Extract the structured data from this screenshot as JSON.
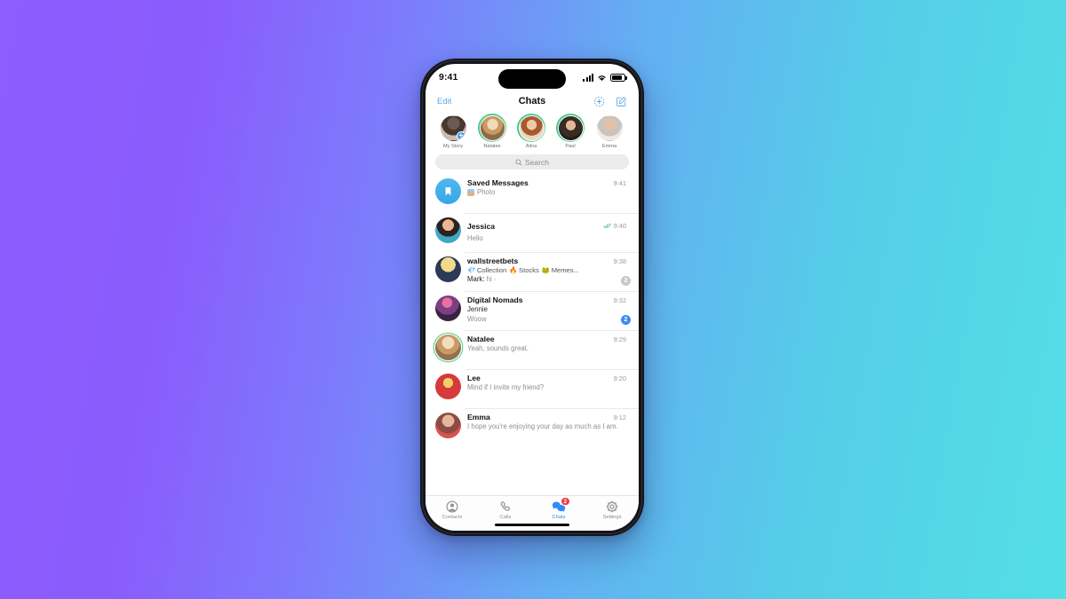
{
  "background": {
    "gradient_from": "#8f5cff",
    "gradient_to": "#53dfe6"
  },
  "phone": {
    "status_bar": {
      "time": "9:41",
      "signal_icon": "cellular-bars-icon",
      "wifi_icon": "wifi-icon",
      "battery_icon": "battery-icon"
    },
    "nav_bar": {
      "edit_label": "Edit",
      "title": "Chats",
      "new_story_icon": "add-story-icon",
      "compose_icon": "compose-icon"
    },
    "stories": [
      {
        "name": "My Story",
        "unread": false,
        "add_badge": "+"
      },
      {
        "name": "Natalee",
        "unread": true
      },
      {
        "name": "Alina",
        "unread": true
      },
      {
        "name": "Paul",
        "unread": true
      },
      {
        "name": "Emma",
        "unread": false
      }
    ],
    "search": {
      "placeholder": "Search",
      "icon": "search-icon"
    },
    "chats": [
      {
        "name": "Saved Messages",
        "avatar_type": "saved-bookmark",
        "preview": "Photo",
        "has_thumb": true,
        "time": "9:41"
      },
      {
        "name": "Jessica",
        "preview": "Hello",
        "time": "9:40",
        "read_receipt": "double-check"
      },
      {
        "name": "wallstreetbets",
        "topics": [
          {
            "emoji": "💎",
            "label": "Collection"
          },
          {
            "emoji": "🔥",
            "label": "Stocks"
          },
          {
            "emoji": "🐸",
            "label": "Memes..."
          }
        ],
        "sender": "Mark:",
        "preview": "hi",
        "chevron": "›",
        "time": "9:38",
        "badge": "2",
        "badge_style": "muted"
      },
      {
        "name": "Digital Nomads",
        "sender": "Jennie",
        "preview": "Woow",
        "time": "9:32",
        "badge": "2",
        "badge_style": "blue"
      },
      {
        "name": "Natalee",
        "preview": "Yeah, sounds great.",
        "time": "9:29",
        "story_ring": true
      },
      {
        "name": "Lee",
        "preview": "Mind if I invite my friend?",
        "time": "9:20"
      },
      {
        "name": "Emma",
        "preview": "I hope you're enjoying your day as much as I am.",
        "time": "9:12"
      }
    ],
    "tabs": [
      {
        "label": "Contacts",
        "icon": "person-icon",
        "active": false
      },
      {
        "label": "Calls",
        "icon": "phone-icon",
        "active": false
      },
      {
        "label": "Chats",
        "icon": "chat-bubbles-icon",
        "active": true,
        "badge": "2"
      },
      {
        "label": "Settings",
        "icon": "gear-icon",
        "active": false
      }
    ]
  }
}
